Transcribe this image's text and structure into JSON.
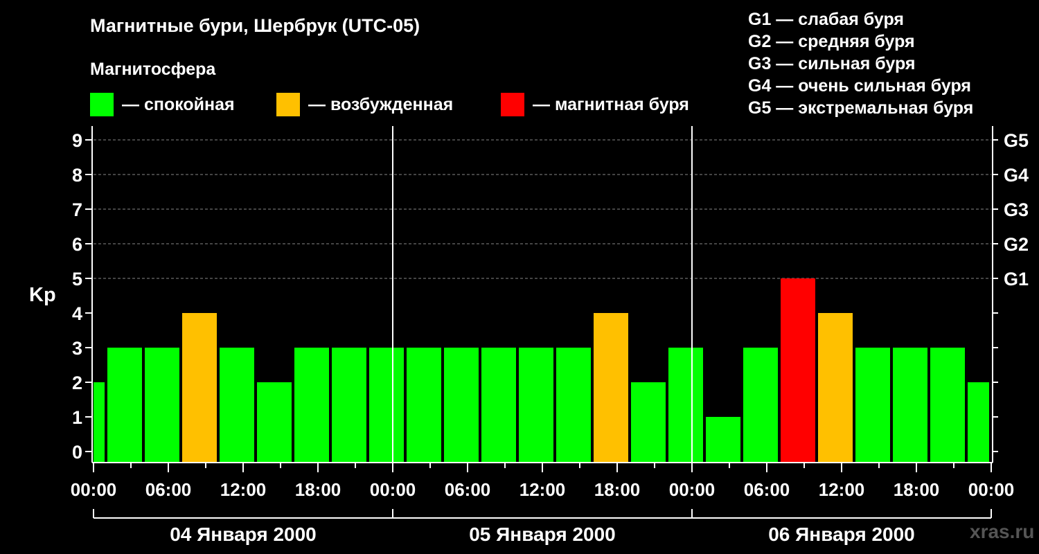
{
  "title": "Магнитные бури, Шербрук (UTC-05)",
  "subtitle": "Магнитосфера",
  "legend": [
    {
      "name": "quiet",
      "label": "— спокойная",
      "color": "#00ff00"
    },
    {
      "name": "unsettled",
      "label": "— возбужденная",
      "color": "#ffc000"
    },
    {
      "name": "storm",
      "label": "— магнитная буря",
      "color": "#ff0000"
    }
  ],
  "g_scale": [
    "G1 — слабая буря",
    "G2 — средняя буря",
    "G3 — сильная буря",
    "G4 — очень сильная буря",
    "G5 — экстремальная буря"
  ],
  "watermark": "xras.ru",
  "chart_data": {
    "type": "bar",
    "ylabel": "Kp",
    "ylim": [
      0,
      9
    ],
    "yticks": [
      0,
      1,
      2,
      3,
      4,
      5,
      6,
      7,
      8,
      9
    ],
    "right_labels": [
      {
        "kp": 5,
        "label": "G1"
      },
      {
        "kp": 6,
        "label": "G2"
      },
      {
        "kp": 7,
        "label": "G3"
      },
      {
        "kp": 8,
        "label": "G4"
      },
      {
        "kp": 9,
        "label": "G5"
      }
    ],
    "hours_total": 72,
    "x_tick_hours": [
      0,
      6,
      12,
      18,
      24,
      30,
      36,
      42,
      48,
      54,
      60,
      66,
      72
    ],
    "x_tick_labels": [
      "00:00",
      "06:00",
      "12:00",
      "18:00",
      "00:00",
      "06:00",
      "12:00",
      "18:00",
      "00:00",
      "06:00",
      "12:00",
      "18:00",
      "00:00"
    ],
    "days": [
      "04 Января 2000",
      "05 Января 2000",
      "06 Января 2000"
    ],
    "bars": [
      {
        "start_hour": 0,
        "end_hour": 1,
        "kp": 2,
        "status": "quiet"
      },
      {
        "start_hour": 1,
        "end_hour": 4,
        "kp": 3,
        "status": "quiet"
      },
      {
        "start_hour": 4,
        "end_hour": 7,
        "kp": 3,
        "status": "quiet"
      },
      {
        "start_hour": 7,
        "end_hour": 10,
        "kp": 4,
        "status": "unsettled"
      },
      {
        "start_hour": 10,
        "end_hour": 13,
        "kp": 3,
        "status": "quiet"
      },
      {
        "start_hour": 13,
        "end_hour": 16,
        "kp": 2,
        "status": "quiet"
      },
      {
        "start_hour": 16,
        "end_hour": 19,
        "kp": 3,
        "status": "quiet"
      },
      {
        "start_hour": 19,
        "end_hour": 22,
        "kp": 3,
        "status": "quiet"
      },
      {
        "start_hour": 22,
        "end_hour": 25,
        "kp": 3,
        "status": "quiet"
      },
      {
        "start_hour": 25,
        "end_hour": 28,
        "kp": 3,
        "status": "quiet"
      },
      {
        "start_hour": 28,
        "end_hour": 31,
        "kp": 3,
        "status": "quiet"
      },
      {
        "start_hour": 31,
        "end_hour": 34,
        "kp": 3,
        "status": "quiet"
      },
      {
        "start_hour": 34,
        "end_hour": 37,
        "kp": 3,
        "status": "quiet"
      },
      {
        "start_hour": 37,
        "end_hour": 40,
        "kp": 3,
        "status": "quiet"
      },
      {
        "start_hour": 40,
        "end_hour": 43,
        "kp": 4,
        "status": "unsettled"
      },
      {
        "start_hour": 43,
        "end_hour": 46,
        "kp": 2,
        "status": "quiet"
      },
      {
        "start_hour": 46,
        "end_hour": 49,
        "kp": 3,
        "status": "quiet"
      },
      {
        "start_hour": 49,
        "end_hour": 52,
        "kp": 1,
        "status": "quiet"
      },
      {
        "start_hour": 52,
        "end_hour": 55,
        "kp": 3,
        "status": "quiet"
      },
      {
        "start_hour": 55,
        "end_hour": 58,
        "kp": 5,
        "status": "storm"
      },
      {
        "start_hour": 58,
        "end_hour": 61,
        "kp": 4,
        "status": "unsettled"
      },
      {
        "start_hour": 61,
        "end_hour": 64,
        "kp": 3,
        "status": "quiet"
      },
      {
        "start_hour": 64,
        "end_hour": 67,
        "kp": 3,
        "status": "quiet"
      },
      {
        "start_hour": 67,
        "end_hour": 70,
        "kp": 3,
        "status": "quiet"
      },
      {
        "start_hour": 70,
        "end_hour": 72,
        "kp": 2,
        "status": "quiet"
      }
    ],
    "colors": {
      "quiet": "#00ff00",
      "unsettled": "#ffc000",
      "storm": "#ff0000"
    }
  }
}
